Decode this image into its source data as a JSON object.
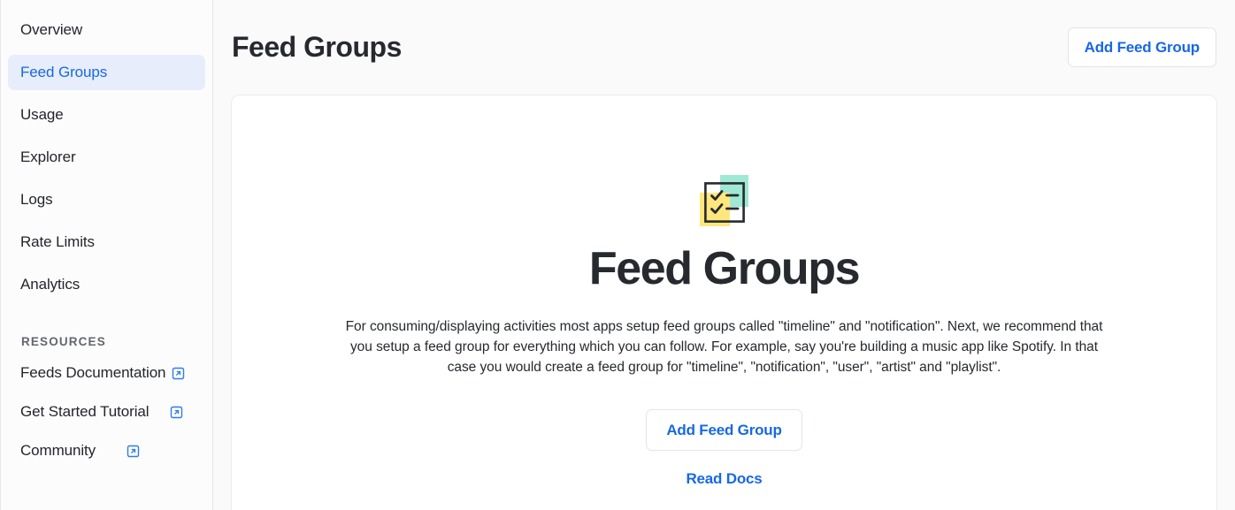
{
  "sidebar": {
    "nav": [
      {
        "label": "Overview",
        "active": false
      },
      {
        "label": "Feed Groups",
        "active": true
      },
      {
        "label": "Usage",
        "active": false
      },
      {
        "label": "Explorer",
        "active": false
      },
      {
        "label": "Logs",
        "active": false
      },
      {
        "label": "Rate Limits",
        "active": false
      },
      {
        "label": "Analytics",
        "active": false
      }
    ],
    "resources_heading": "RESOURCES",
    "resources": [
      {
        "label": "Feeds Documentation",
        "icon": "external-link-icon"
      },
      {
        "label": "Get Started Tutorial",
        "icon": "external-link-icon"
      },
      {
        "label": "Community",
        "icon": "external-link-icon"
      }
    ]
  },
  "header": {
    "title": "Feed Groups",
    "add_button_label": "Add Feed Group"
  },
  "empty_state": {
    "illustration_icon": "checklist-icon",
    "title": "Feed Groups",
    "description": "For consuming/displaying activities most apps setup feed groups called \"timeline\" and \"notification\". Next, we recommend that you setup a feed group for everything which you can follow. For example, say you're building a music app like Spotify. In that case you would create a feed group for \"timeline\", \"notification\", \"user\", \"artist\" and \"playlist\".",
    "add_button_label": "Add Feed Group",
    "read_docs_label": "Read Docs"
  },
  "colors": {
    "accent_blue": "#1768e5",
    "active_nav_bg": "#e7edfb",
    "illustration_teal": "#9fe8d4",
    "illustration_yellow": "#ffe77e",
    "page_bg": "#fafafb",
    "text_primary": "#262a2f"
  }
}
